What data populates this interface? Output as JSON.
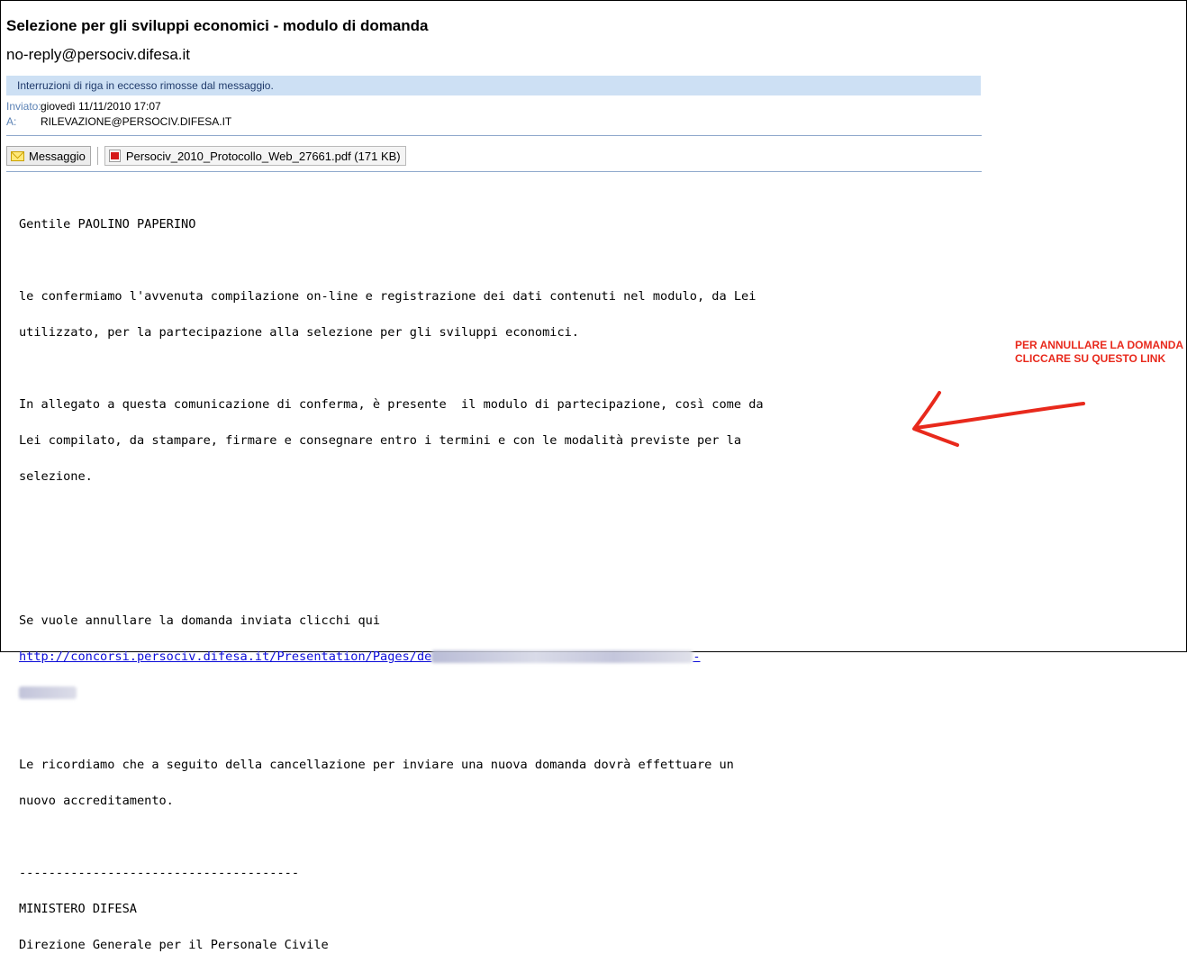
{
  "email": {
    "subject": "Selezione per gli sviluppi economici - modulo di domanda",
    "from": "no-reply@persociv.difesa.it",
    "info_bar": "Interruzioni di riga in eccesso rimosse dal messaggio.",
    "sent_label": "Inviato:",
    "sent_value": "giovedì 11/11/2010 17:07",
    "to_label": "A:",
    "to_value": "RILEVAZIONE@PERSOCIV.DIFESA.IT",
    "tabs": {
      "message": "Messaggio",
      "attachment": "Persociv_2010_Protocollo_Web_27661.pdf (171 KB)"
    },
    "body": {
      "greeting": "Gentile PAOLINO PAPERINO",
      "para1_line1": "le confermiamo l'avvenuta compilazione on-line e registrazione dei dati contenuti nel modulo, da Lei",
      "para1_line2": "utilizzato, per la partecipazione alla selezione per gli sviluppi economici.",
      "para2_line1": "In allegato a questa comunicazione di conferma, è presente  il modulo di partecipazione, così come da",
      "para2_line2": "Lei compilato, da stampare, firmare e consegnare entro i termini e con le modalità previste per la",
      "para2_line3": "selezione.",
      "cancel_text": "Se vuole annullare la domanda inviata clicchi qui",
      "link_start": "http://concorsi.persociv.difesa.it/Presentation/Pages/de",
      "link_end": "-",
      "para3_line1": "Le ricordiamo che a seguito della cancellazione per inviare una nuova domanda dovrà effettuare un",
      "para3_line2": "nuovo accreditamento.",
      "divider": "--------------------------------------",
      "sig1": "MINISTERO DIFESA",
      "sig2": "Direzione Generale per il Personale Civile"
    }
  },
  "annotation": {
    "text": "PER ANNULLARE LA DOMANDA CLICCARE SU QUESTO LINK",
    "color": "#e8291c"
  }
}
